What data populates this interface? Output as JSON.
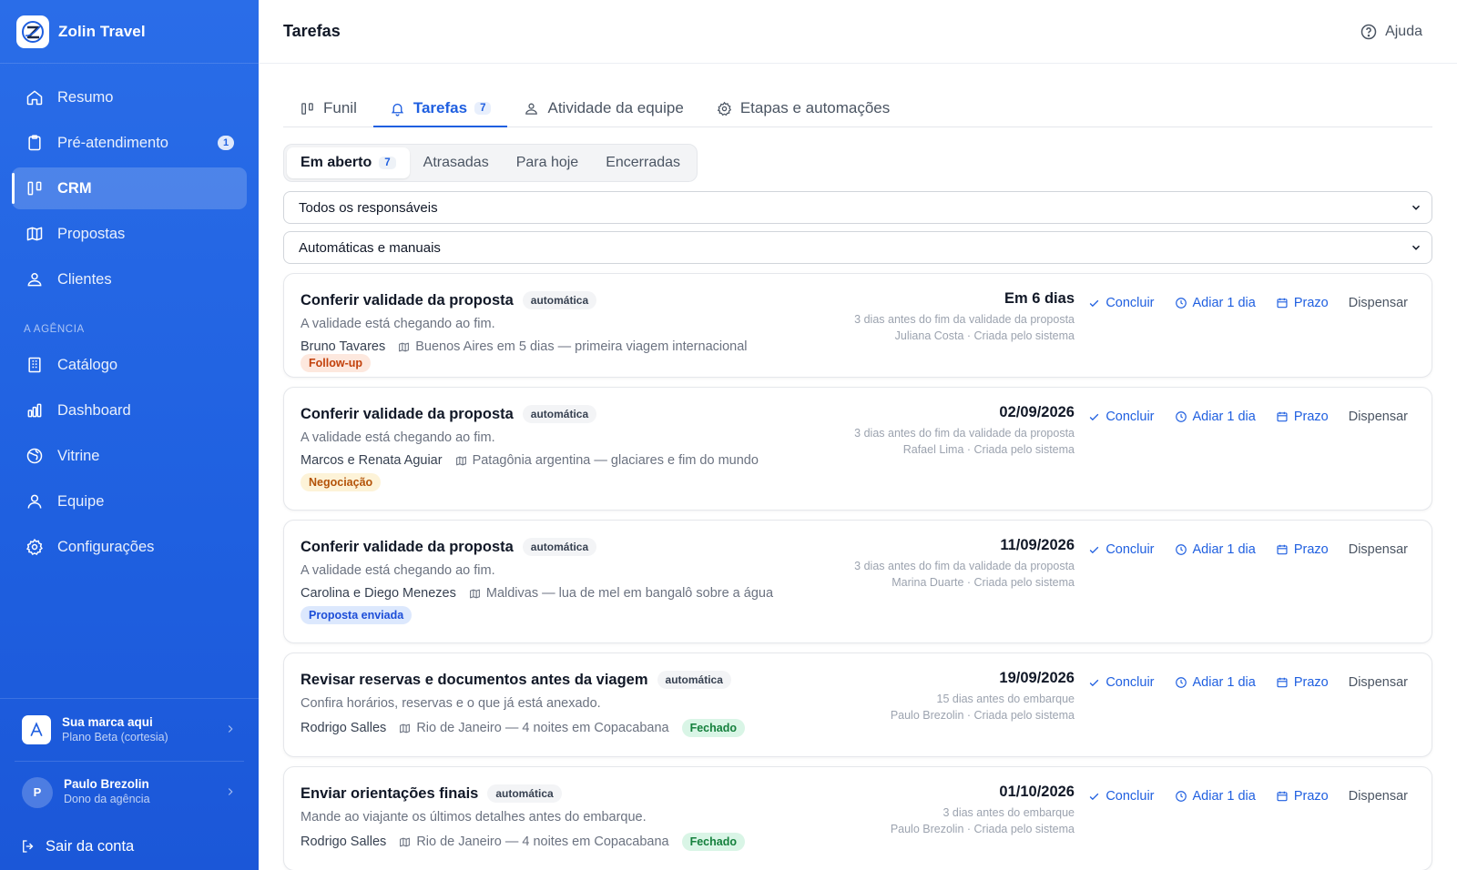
{
  "brand": {
    "name": "Zolin Travel"
  },
  "sidebar": {
    "items": [
      {
        "label": "Resumo",
        "icon": "home-icon"
      },
      {
        "label": "Pré-atendimento",
        "icon": "clipboard-icon",
        "badge": "1"
      },
      {
        "label": "CRM",
        "icon": "kanban-icon",
        "active": true
      },
      {
        "label": "Propostas",
        "icon": "map-icon"
      },
      {
        "label": "Clientes",
        "icon": "users-icon"
      }
    ],
    "section_label": "A AGÊNCIA",
    "agency_items": [
      {
        "label": "Catálogo",
        "icon": "building-icon"
      },
      {
        "label": "Dashboard",
        "icon": "bar-chart-icon"
      },
      {
        "label": "Vitrine",
        "icon": "globe-icon"
      },
      {
        "label": "Equipe",
        "icon": "user-icon"
      },
      {
        "label": "Configurações",
        "icon": "gear-icon"
      }
    ],
    "brand_card": {
      "title": "Sua marca aqui",
      "subtitle": "Plano Beta (cortesia)"
    },
    "user_card": {
      "initial": "P",
      "name": "Paulo Brezolin",
      "role": "Dono da agência"
    },
    "logout_label": "Sair da conta"
  },
  "header": {
    "title": "Tarefas",
    "help_label": "Ajuda"
  },
  "tabs": [
    {
      "label": "Funil"
    },
    {
      "label": "Tarefas",
      "count": "7",
      "active": true
    },
    {
      "label": "Atividade da equipe"
    },
    {
      "label": "Etapas e automações"
    }
  ],
  "filters": {
    "segments": [
      {
        "label": "Em aberto",
        "count": "7",
        "active": true
      },
      {
        "label": "Atrasadas"
      },
      {
        "label": "Para hoje"
      },
      {
        "label": "Encerradas"
      }
    ],
    "responsible_select": "Todos os responsáveis",
    "type_select": "Automáticas e manuais"
  },
  "actions": {
    "complete": "Concluir",
    "postpone": "Adiar 1 dia",
    "deadline": "Prazo",
    "dismiss": "Dispensar"
  },
  "tasks": [
    {
      "title": "Conferir validade da proposta",
      "tag": "automática",
      "description": "A validade está chegando ao fim.",
      "client": "Bruno Tavares",
      "trip": "Buenos Aires em 5 dias — primeira viagem internacional",
      "stage": "Follow-up",
      "due": "Em 6 dias",
      "due_rule": "3 dias antes do fim da validade da proposta",
      "owner": "Juliana Costa · Criada pelo sistema"
    },
    {
      "title": "Conferir validade da proposta",
      "tag": "automática",
      "description": "A validade está chegando ao fim.",
      "client": "Marcos e Renata Aguiar",
      "trip": "Patagônia argentina — glaciares e fim do mundo",
      "stage": "Negociação",
      "due": "02/09/2026",
      "due_rule": "3 dias antes do fim da validade da proposta",
      "owner": "Rafael Lima · Criada pelo sistema"
    },
    {
      "title": "Conferir validade da proposta",
      "tag": "automática",
      "description": "A validade está chegando ao fim.",
      "client": "Carolina e Diego Menezes",
      "trip": "Maldivas — lua de mel em bangalô sobre a água",
      "stage": "Proposta enviada",
      "due": "11/09/2026",
      "due_rule": "3 dias antes do fim da validade da proposta",
      "owner": "Marina Duarte · Criada pelo sistema"
    },
    {
      "title": "Revisar reservas e documentos antes da viagem",
      "tag": "automática",
      "description": "Confira horários, reservas e o que já está anexado.",
      "client": "Rodrigo Salles",
      "trip": "Rio de Janeiro — 4 noites em Copacabana",
      "stage": "Fechado",
      "due": "19/09/2026",
      "due_rule": "15 dias antes do embarque",
      "owner": "Paulo Brezolin · Criada pelo sistema"
    },
    {
      "title": "Enviar orientações finais",
      "tag": "automática",
      "description": "Mande ao viajante os últimos detalhes antes do embarque.",
      "client": "Rodrigo Salles",
      "trip": "Rio de Janeiro — 4 noites em Copacabana",
      "stage": "Fechado",
      "due": "01/10/2026",
      "due_rule": "3 dias antes do embarque",
      "owner": "Paulo Brezolin · Criada pelo sistema"
    }
  ]
}
